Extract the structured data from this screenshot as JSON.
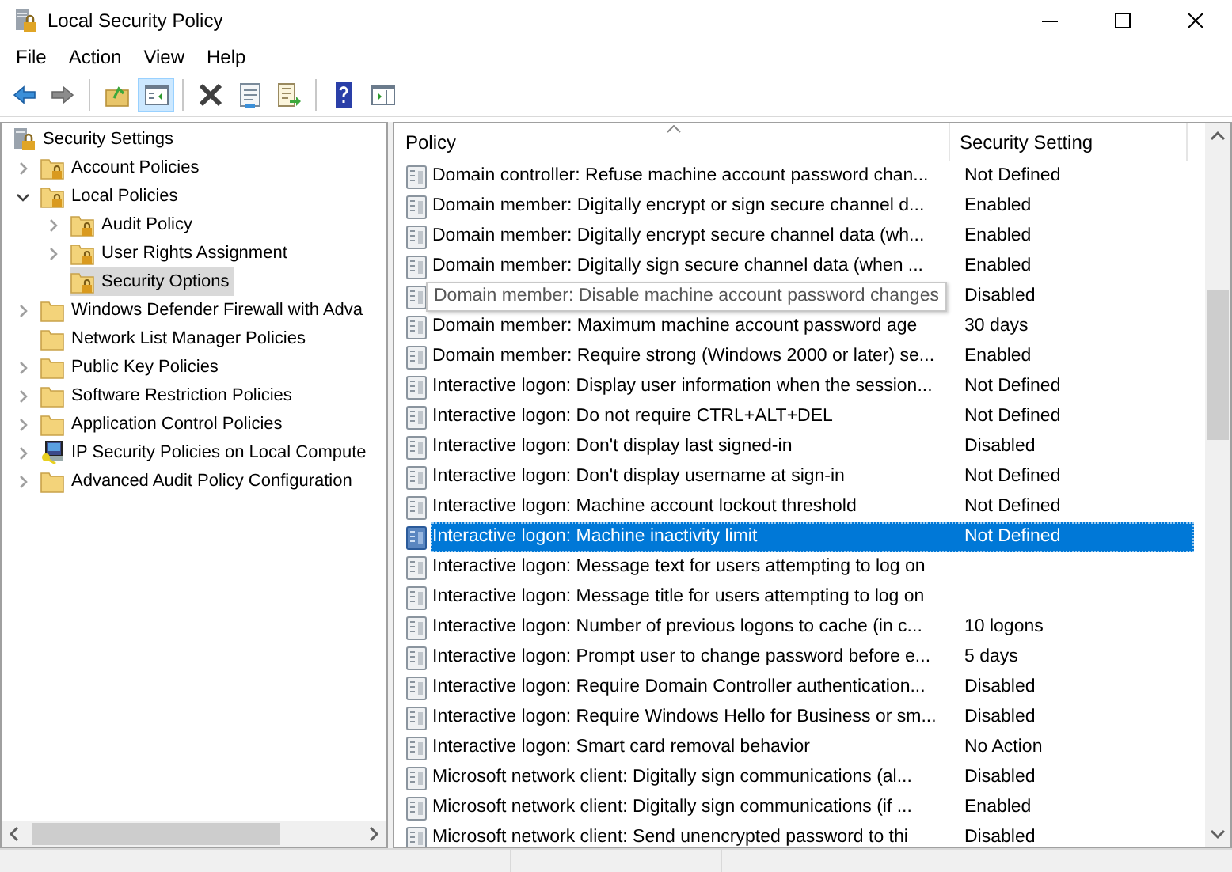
{
  "window": {
    "title": "Local Security Policy"
  },
  "menu": [
    "File",
    "Action",
    "View",
    "Help"
  ],
  "toolbar": [
    {
      "kind": "back",
      "pressed": false
    },
    {
      "kind": "forward",
      "pressed": false
    },
    {
      "kind": "sep"
    },
    {
      "kind": "up",
      "pressed": false
    },
    {
      "kind": "tree",
      "pressed": true
    },
    {
      "kind": "sep"
    },
    {
      "kind": "delete",
      "pressed": false
    },
    {
      "kind": "properties",
      "pressed": false
    },
    {
      "kind": "export",
      "pressed": false
    },
    {
      "kind": "sep"
    },
    {
      "kind": "help",
      "pressed": false
    },
    {
      "kind": "pane",
      "pressed": false
    }
  ],
  "tree": {
    "label": "Security Settings",
    "kind": "root",
    "selected": false,
    "children": [
      {
        "label": "Account Policies",
        "kind": "locked",
        "selected": false,
        "expanded": false
      },
      {
        "label": "Local Policies",
        "kind": "locked",
        "selected": false,
        "expanded": true,
        "children": [
          {
            "label": "Audit Policy",
            "kind": "locked",
            "selected": false,
            "expanded": false
          },
          {
            "label": "User Rights Assignment",
            "kind": "locked",
            "selected": false,
            "expanded": false
          },
          {
            "label": "Security Options",
            "kind": "locked",
            "selected": true
          }
        ]
      },
      {
        "label": "Windows Defender Firewall with Adva",
        "kind": "plain",
        "selected": false,
        "expanded": false
      },
      {
        "label": "Network List Manager Policies",
        "kind": "plain",
        "selected": false
      },
      {
        "label": "Public Key Policies",
        "kind": "plain",
        "selected": false,
        "expanded": false
      },
      {
        "label": "Software Restriction Policies",
        "kind": "plain",
        "selected": false,
        "expanded": false
      },
      {
        "label": "Application Control Policies",
        "kind": "plain",
        "selected": false,
        "expanded": false
      },
      {
        "label": "IP Security Policies on Local Compute",
        "kind": "ipsec",
        "selected": false,
        "expanded": false
      },
      {
        "label": "Advanced Audit Policy Configuration",
        "kind": "plain",
        "selected": false,
        "expanded": false
      }
    ]
  },
  "table": {
    "columns": [
      "Policy",
      "Security Setting"
    ],
    "rows": [
      {
        "policy": "Domain controller: Refuse machine account password chan...",
        "setting": "Not Defined",
        "selected": false,
        "tooltip": false
      },
      {
        "policy": "Domain member: Digitally encrypt or sign secure channel d...",
        "setting": "Enabled",
        "selected": false,
        "tooltip": false
      },
      {
        "policy": "Domain member: Digitally encrypt secure channel data (wh...",
        "setting": "Enabled",
        "selected": false,
        "tooltip": false
      },
      {
        "policy": "Domain member: Digitally sign secure channel data (when ...",
        "setting": "Enabled",
        "selected": false,
        "tooltip": false
      },
      {
        "policy": "Domain member: Disable machine account password changes",
        "setting": "Disabled",
        "selected": false,
        "tooltip": true
      },
      {
        "policy": "Domain member: Maximum machine account password age",
        "setting": "30 days",
        "selected": false,
        "tooltip": false
      },
      {
        "policy": "Domain member: Require strong (Windows 2000 or later) se...",
        "setting": "Enabled",
        "selected": false,
        "tooltip": false
      },
      {
        "policy": "Interactive logon: Display user information when the session...",
        "setting": "Not Defined",
        "selected": false,
        "tooltip": false
      },
      {
        "policy": "Interactive logon: Do not require CTRL+ALT+DEL",
        "setting": "Not Defined",
        "selected": false,
        "tooltip": false
      },
      {
        "policy": "Interactive logon: Don't display last signed-in",
        "setting": "Disabled",
        "selected": false,
        "tooltip": false
      },
      {
        "policy": "Interactive logon: Don't display username at sign-in",
        "setting": "Not Defined",
        "selected": false,
        "tooltip": false
      },
      {
        "policy": "Interactive logon: Machine account lockout threshold",
        "setting": "Not Defined",
        "selected": false,
        "tooltip": false
      },
      {
        "policy": "Interactive logon: Machine inactivity limit",
        "setting": "Not Defined",
        "selected": true,
        "tooltip": false
      },
      {
        "policy": "Interactive logon: Message text for users attempting to log on",
        "selected": false,
        "tooltip": false
      },
      {
        "policy": "Interactive logon: Message title for users attempting to log on",
        "selected": false,
        "tooltip": false
      },
      {
        "policy": "Interactive logon: Number of previous logons to cache (in c...",
        "setting": "10 logons",
        "selected": false,
        "tooltip": false
      },
      {
        "policy": "Interactive logon: Prompt user to change password before e...",
        "setting": "5 days",
        "selected": false,
        "tooltip": false
      },
      {
        "policy": "Interactive logon: Require Domain Controller authentication...",
        "setting": "Disabled",
        "selected": false,
        "tooltip": false
      },
      {
        "policy": "Interactive logon: Require Windows Hello for Business or sm...",
        "setting": "Disabled",
        "selected": false,
        "tooltip": false
      },
      {
        "policy": "Interactive logon: Smart card removal behavior",
        "setting": "No Action",
        "selected": false,
        "tooltip": false
      },
      {
        "policy": "Microsoft network client: Digitally sign communications (al...",
        "setting": "Disabled",
        "selected": false,
        "tooltip": false
      },
      {
        "policy": "Microsoft network client: Digitally sign communications (if ...",
        "setting": "Enabled",
        "selected": false,
        "tooltip": false
      },
      {
        "policy": "Microsoft network client: Send unencrypted password to thi",
        "setting": "Disabled",
        "selected": false,
        "tooltip": false
      }
    ]
  }
}
